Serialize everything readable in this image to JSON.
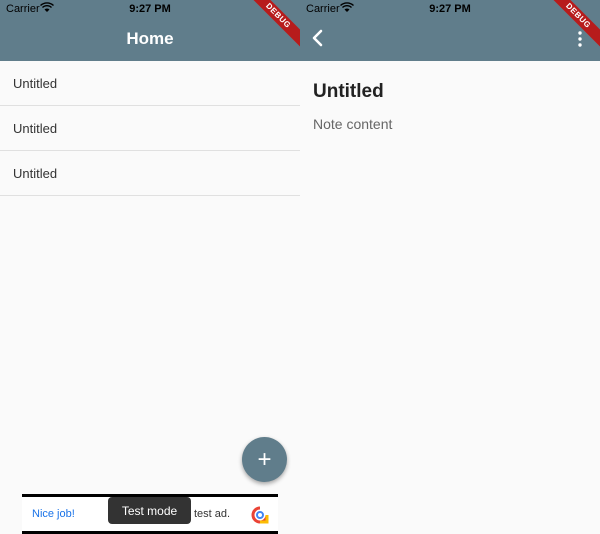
{
  "status": {
    "carrier": "Carrier",
    "time": "9:27 PM"
  },
  "debug_label": "DEBUG",
  "home": {
    "title": "Home",
    "notes": [
      "Untitled",
      "Untitled",
      "Untitled"
    ],
    "fab_label": "+"
  },
  "ad": {
    "left_text": "Nice job!",
    "right_text": "test ad.",
    "toast": "Test mode"
  },
  "detail": {
    "note_title": "Untitled",
    "note_content_placeholder": "Note content"
  },
  "colors": {
    "appbar": "#607d8b",
    "fab": "#607d8b",
    "debug_banner": "#b71c1c"
  },
  "icons": {
    "back": "back-icon",
    "more": "more-vert-icon",
    "wifi": "wifi-icon",
    "ad_logo": "ad-logo-icon"
  }
}
